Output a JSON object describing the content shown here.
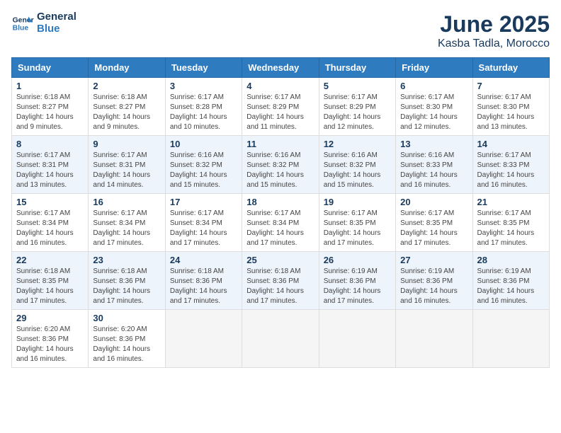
{
  "header": {
    "logo_line1": "General",
    "logo_line2": "Blue",
    "month": "June 2025",
    "location": "Kasba Tadla, Morocco"
  },
  "days_of_week": [
    "Sunday",
    "Monday",
    "Tuesday",
    "Wednesday",
    "Thursday",
    "Friday",
    "Saturday"
  ],
  "weeks": [
    [
      {
        "day": "1",
        "sunrise": "6:18 AM",
        "sunset": "8:27 PM",
        "daylight": "14 hours and 9 minutes."
      },
      {
        "day": "2",
        "sunrise": "6:18 AM",
        "sunset": "8:27 PM",
        "daylight": "14 hours and 9 minutes."
      },
      {
        "day": "3",
        "sunrise": "6:17 AM",
        "sunset": "8:28 PM",
        "daylight": "14 hours and 10 minutes."
      },
      {
        "day": "4",
        "sunrise": "6:17 AM",
        "sunset": "8:29 PM",
        "daylight": "14 hours and 11 minutes."
      },
      {
        "day": "5",
        "sunrise": "6:17 AM",
        "sunset": "8:29 PM",
        "daylight": "14 hours and 12 minutes."
      },
      {
        "day": "6",
        "sunrise": "6:17 AM",
        "sunset": "8:30 PM",
        "daylight": "14 hours and 12 minutes."
      },
      {
        "day": "7",
        "sunrise": "6:17 AM",
        "sunset": "8:30 PM",
        "daylight": "14 hours and 13 minutes."
      }
    ],
    [
      {
        "day": "8",
        "sunrise": "6:17 AM",
        "sunset": "8:31 PM",
        "daylight": "14 hours and 13 minutes."
      },
      {
        "day": "9",
        "sunrise": "6:17 AM",
        "sunset": "8:31 PM",
        "daylight": "14 hours and 14 minutes."
      },
      {
        "day": "10",
        "sunrise": "6:16 AM",
        "sunset": "8:32 PM",
        "daylight": "14 hours and 15 minutes."
      },
      {
        "day": "11",
        "sunrise": "6:16 AM",
        "sunset": "8:32 PM",
        "daylight": "14 hours and 15 minutes."
      },
      {
        "day": "12",
        "sunrise": "6:16 AM",
        "sunset": "8:32 PM",
        "daylight": "14 hours and 15 minutes."
      },
      {
        "day": "13",
        "sunrise": "6:16 AM",
        "sunset": "8:33 PM",
        "daylight": "14 hours and 16 minutes."
      },
      {
        "day": "14",
        "sunrise": "6:17 AM",
        "sunset": "8:33 PM",
        "daylight": "14 hours and 16 minutes."
      }
    ],
    [
      {
        "day": "15",
        "sunrise": "6:17 AM",
        "sunset": "8:34 PM",
        "daylight": "14 hours and 16 minutes."
      },
      {
        "day": "16",
        "sunrise": "6:17 AM",
        "sunset": "8:34 PM",
        "daylight": "14 hours and 17 minutes."
      },
      {
        "day": "17",
        "sunrise": "6:17 AM",
        "sunset": "8:34 PM",
        "daylight": "14 hours and 17 minutes."
      },
      {
        "day": "18",
        "sunrise": "6:17 AM",
        "sunset": "8:34 PM",
        "daylight": "14 hours and 17 minutes."
      },
      {
        "day": "19",
        "sunrise": "6:17 AM",
        "sunset": "8:35 PM",
        "daylight": "14 hours and 17 minutes."
      },
      {
        "day": "20",
        "sunrise": "6:17 AM",
        "sunset": "8:35 PM",
        "daylight": "14 hours and 17 minutes."
      },
      {
        "day": "21",
        "sunrise": "6:17 AM",
        "sunset": "8:35 PM",
        "daylight": "14 hours and 17 minutes."
      }
    ],
    [
      {
        "day": "22",
        "sunrise": "6:18 AM",
        "sunset": "8:35 PM",
        "daylight": "14 hours and 17 minutes."
      },
      {
        "day": "23",
        "sunrise": "6:18 AM",
        "sunset": "8:36 PM",
        "daylight": "14 hours and 17 minutes."
      },
      {
        "day": "24",
        "sunrise": "6:18 AM",
        "sunset": "8:36 PM",
        "daylight": "14 hours and 17 minutes."
      },
      {
        "day": "25",
        "sunrise": "6:18 AM",
        "sunset": "8:36 PM",
        "daylight": "14 hours and 17 minutes."
      },
      {
        "day": "26",
        "sunrise": "6:19 AM",
        "sunset": "8:36 PM",
        "daylight": "14 hours and 17 minutes."
      },
      {
        "day": "27",
        "sunrise": "6:19 AM",
        "sunset": "8:36 PM",
        "daylight": "14 hours and 16 minutes."
      },
      {
        "day": "28",
        "sunrise": "6:19 AM",
        "sunset": "8:36 PM",
        "daylight": "14 hours and 16 minutes."
      }
    ],
    [
      {
        "day": "29",
        "sunrise": "6:20 AM",
        "sunset": "8:36 PM",
        "daylight": "14 hours and 16 minutes."
      },
      {
        "day": "30",
        "sunrise": "6:20 AM",
        "sunset": "8:36 PM",
        "daylight": "14 hours and 16 minutes."
      },
      null,
      null,
      null,
      null,
      null
    ]
  ]
}
